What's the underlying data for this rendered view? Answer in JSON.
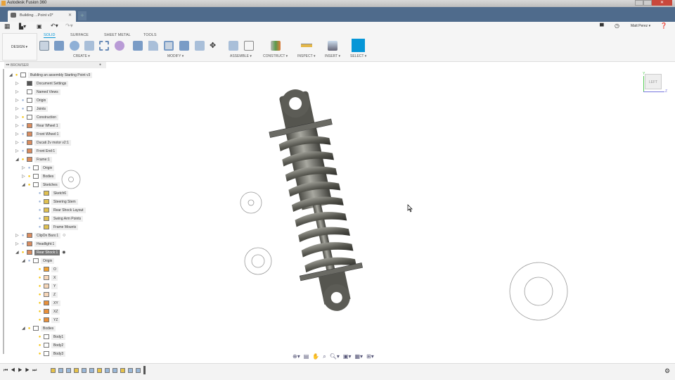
{
  "app": {
    "title": "Autodesk Fusion 360",
    "doc_tab": "Building ...Point v3*"
  },
  "user": {
    "name": "Matt Perez ▾"
  },
  "workspace": "DESIGN ▾",
  "ribbon": {
    "tabs": [
      "SOLID",
      "SURFACE",
      "SHEET METAL",
      "TOOLS"
    ],
    "active_tab": "SOLID",
    "groups": [
      "CREATE ▾",
      "MODIFY ▾",
      "ASSEMBLE ▾",
      "CONSTRUCT ▾",
      "INSPECT ▾",
      "INSERT ▾",
      "SELECT ▾"
    ]
  },
  "browser": {
    "title": "BROWSER",
    "rows": [
      {
        "label": "Building an assembly Starting Point v3",
        "level": 0,
        "exp": "open",
        "bulb": "on",
        "icon": "document"
      },
      {
        "label": "Document Settings",
        "level": 1,
        "exp": "closed",
        "bulb": "",
        "icon": "gear"
      },
      {
        "label": "Named Views",
        "level": 1,
        "exp": "closed",
        "bulb": "",
        "icon": "folder"
      },
      {
        "label": "Origin",
        "level": 1,
        "exp": "closed",
        "bulb": "off",
        "icon": "folder"
      },
      {
        "label": "Joints",
        "level": 1,
        "exp": "closed",
        "bulb": "off",
        "icon": "folder"
      },
      {
        "label": "Construction",
        "level": 1,
        "exp": "closed",
        "bulb": "on",
        "icon": "folder"
      },
      {
        "label": "Rear Wheel:1",
        "level": 1,
        "exp": "closed",
        "bulb": "off",
        "icon": "component"
      },
      {
        "label": "Front Wheel:1",
        "level": 1,
        "exp": "closed",
        "bulb": "off",
        "icon": "component"
      },
      {
        "label": "Ducati 2v motor v2:1",
        "level": 1,
        "exp": "closed",
        "bulb": "off",
        "icon": "component"
      },
      {
        "label": "Front End:1",
        "level": 1,
        "exp": "closed",
        "bulb": "off",
        "icon": "component"
      },
      {
        "label": "Frame:1",
        "level": 1,
        "exp": "open",
        "bulb": "on",
        "icon": "component"
      },
      {
        "label": "Origin",
        "level": 2,
        "exp": "closed",
        "bulb": "off",
        "icon": "folder"
      },
      {
        "label": "Bodies",
        "level": 2,
        "exp": "closed",
        "bulb": "on",
        "icon": "folder"
      },
      {
        "label": "Sketches",
        "level": 2,
        "exp": "open",
        "bulb": "on",
        "icon": "folder"
      },
      {
        "label": "Sketch6",
        "level": 3,
        "exp": "",
        "bulb": "off",
        "icon": "sketch"
      },
      {
        "label": "Steering Stem",
        "level": 3,
        "exp": "",
        "bulb": "off",
        "icon": "sketch"
      },
      {
        "label": "Rear Shock Layout",
        "level": 3,
        "exp": "",
        "bulb": "off",
        "icon": "sketch"
      },
      {
        "label": "Swing Arm Points",
        "level": 3,
        "exp": "",
        "bulb": "off",
        "icon": "sketch"
      },
      {
        "label": "Frame Mounts",
        "level": 3,
        "exp": "",
        "bulb": "off",
        "icon": "sketch"
      },
      {
        "label": "ClipOn Bars:1",
        "level": 1,
        "exp": "closed",
        "bulb": "off",
        "icon": "component"
      },
      {
        "label": "Headlight:1",
        "level": 1,
        "exp": "closed",
        "bulb": "off",
        "icon": "component"
      },
      {
        "label": "Rear Shock:1",
        "level": 1,
        "exp": "open",
        "bulb": "on",
        "icon": "component",
        "selected": true
      },
      {
        "label": "Origin",
        "level": 2,
        "exp": "open",
        "bulb": "off",
        "icon": "folder"
      },
      {
        "label": "O",
        "level": 3,
        "exp": "",
        "bulb": "on",
        "icon": "point"
      },
      {
        "label": "X",
        "level": 3,
        "exp": "",
        "bulb": "on",
        "icon": "axis"
      },
      {
        "label": "Y",
        "level": 3,
        "exp": "",
        "bulb": "on",
        "icon": "axis"
      },
      {
        "label": "Z",
        "level": 3,
        "exp": "",
        "bulb": "on",
        "icon": "axis"
      },
      {
        "label": "XY",
        "level": 3,
        "exp": "",
        "bulb": "on",
        "icon": "plane"
      },
      {
        "label": "XZ",
        "level": 3,
        "exp": "",
        "bulb": "on",
        "icon": "plane"
      },
      {
        "label": "YZ",
        "level": 3,
        "exp": "",
        "bulb": "on",
        "icon": "plane"
      },
      {
        "label": "Bodies",
        "level": 2,
        "exp": "open",
        "bulb": "on",
        "icon": "folder"
      },
      {
        "label": "Body1",
        "level": 3,
        "exp": "",
        "bulb": "on",
        "icon": "body"
      },
      {
        "label": "Body2",
        "level": 3,
        "exp": "",
        "bulb": "on",
        "icon": "body"
      },
      {
        "label": "Body3",
        "level": 3,
        "exp": "",
        "bulb": "on",
        "icon": "body"
      }
    ]
  },
  "viewcube": {
    "face": "LEFT",
    "axis_y": "Y",
    "axis_z": "Z"
  },
  "colors": {
    "tabbar": "#4f6b8c",
    "accent": "#0696d7",
    "bulb_on": "#f5c518",
    "bulb_off": "#9db4d8"
  }
}
